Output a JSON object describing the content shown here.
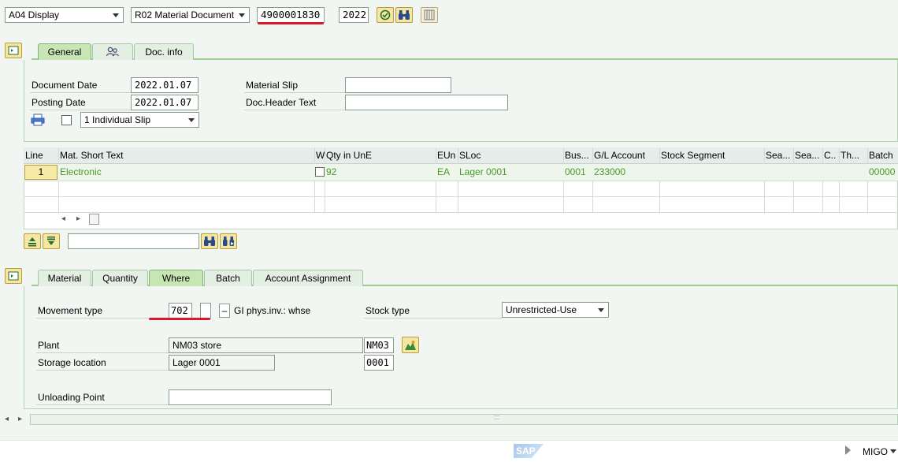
{
  "toolbar": {
    "action_select": "A04 Display",
    "reference_select": "R02 Material Document",
    "document_number": "4900001830",
    "year": "2022"
  },
  "header_tabs": {
    "general": "General",
    "partner_icon": "partner-icon",
    "doc_info": "Doc. info"
  },
  "header": {
    "document_date_label": "Document Date",
    "document_date": "2022.01.07",
    "posting_date_label": "Posting Date",
    "posting_date": "2022.01.07",
    "material_slip_label": "Material Slip",
    "material_slip": "",
    "doc_header_text_label": "Doc.Header Text",
    "doc_header_text": "",
    "print_option": "1 Individual Slip"
  },
  "items_table": {
    "columns": [
      "Line",
      "Mat. Short Text",
      "W",
      "Qty in UnE",
      "EUn",
      "SLoc",
      "Bus...",
      "G/L Account",
      "Stock Segment",
      "Sea...",
      "Sea...",
      "C..",
      "Th...",
      "Batch"
    ],
    "rows": [
      {
        "line": "1",
        "mat_short_text": "Electronic",
        "w": "",
        "qty": "92",
        "eun": "EA",
        "sloc": "Lager 0001",
        "bus": "0001",
        "gl_account": "233000",
        "stock_segment": "",
        "sea1": "",
        "sea2": "",
        "c": "",
        "th": "",
        "batch": "00000"
      }
    ],
    "search_value": ""
  },
  "detail_tabs": {
    "material": "Material",
    "quantity": "Quantity",
    "where": "Where",
    "batch": "Batch",
    "account_assignment": "Account Assignment"
  },
  "detail": {
    "movement_type_label": "Movement type",
    "movement_type": "702",
    "movement_type_extra": "",
    "movement_sign": "–",
    "movement_desc": "GI phys.inv.: whse",
    "stock_type_label": "Stock type",
    "stock_type": "Unrestricted-Use",
    "plant_label": "Plant",
    "plant_name": "NM03 store",
    "plant_code": "NM03",
    "storage_location_label": "Storage location",
    "storage_location_name": "Lager 0001",
    "storage_location_code": "0001",
    "unloading_point_label": "Unloading Point",
    "unloading_point": ""
  },
  "status_bar": {
    "transaction": "MIGO",
    "sap_logo": "SAP",
    "splitter_handle": ":::"
  },
  "colors": {
    "accent_green": "#4a9a2a",
    "annotation_red": "#d9182c",
    "tab_active": "#c8e6b4"
  }
}
